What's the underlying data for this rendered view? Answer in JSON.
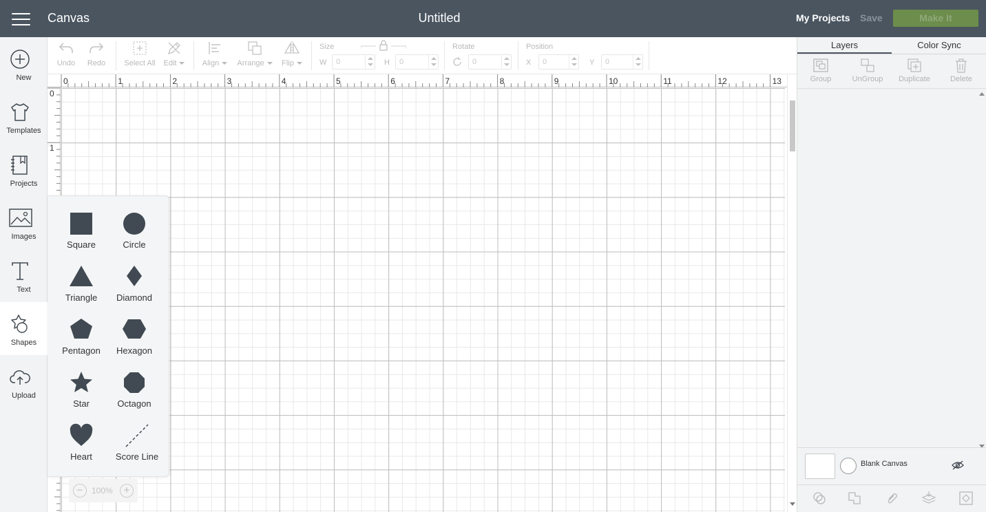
{
  "header": {
    "app_title": "Canvas",
    "doc_title": "Untitled",
    "my_projects": "My Projects",
    "save": "Save",
    "make_it": "Make It"
  },
  "left_nav": {
    "new": "New",
    "templates": "Templates",
    "projects": "Projects",
    "images": "Images",
    "text": "Text",
    "shapes": "Shapes",
    "upload": "Upload"
  },
  "toolbar": {
    "undo": "Undo",
    "redo": "Redo",
    "select_all": "Select All",
    "edit": "Edit",
    "align": "Align",
    "arrange": "Arrange",
    "flip": "Flip",
    "size_label": "Size",
    "w_label": "W",
    "w_value": "0",
    "h_label": "H",
    "h_value": "0",
    "rotate_label": "Rotate",
    "rotate_value": "0",
    "position_label": "Position",
    "x_label": "X",
    "x_value": "0",
    "y_label": "Y",
    "y_value": "0"
  },
  "ruler": {
    "top": [
      "0",
      "1",
      "2",
      "3",
      "4",
      "5",
      "6",
      "7",
      "8",
      "9",
      "10",
      "11",
      "12",
      "13"
    ],
    "left": [
      "0",
      "1"
    ]
  },
  "shapes": [
    {
      "label": "Square",
      "icon": "square-icon"
    },
    {
      "label": "Circle",
      "icon": "circle-icon"
    },
    {
      "label": "Triangle",
      "icon": "triangle-icon"
    },
    {
      "label": "Diamond",
      "icon": "diamond-icon"
    },
    {
      "label": "Pentagon",
      "icon": "pentagon-icon"
    },
    {
      "label": "Hexagon",
      "icon": "hexagon-icon"
    },
    {
      "label": "Star",
      "icon": "star-icon"
    },
    {
      "label": "Octagon",
      "icon": "octagon-icon"
    },
    {
      "label": "Heart",
      "icon": "heart-icon"
    },
    {
      "label": "Score Line",
      "icon": "score-line-icon"
    }
  ],
  "zoom": {
    "value": "100%"
  },
  "right_panel": {
    "tab_layers": "Layers",
    "tab_color_sync": "Color Sync",
    "group": "Group",
    "ungroup": "UnGroup",
    "duplicate": "Duplicate",
    "delete": "Delete",
    "blank_canvas": "Blank Canvas"
  },
  "colors": {
    "header_bg": "#4a5560",
    "make_it_bg": "#6c8d4b",
    "shape_fill": "#414a52"
  }
}
